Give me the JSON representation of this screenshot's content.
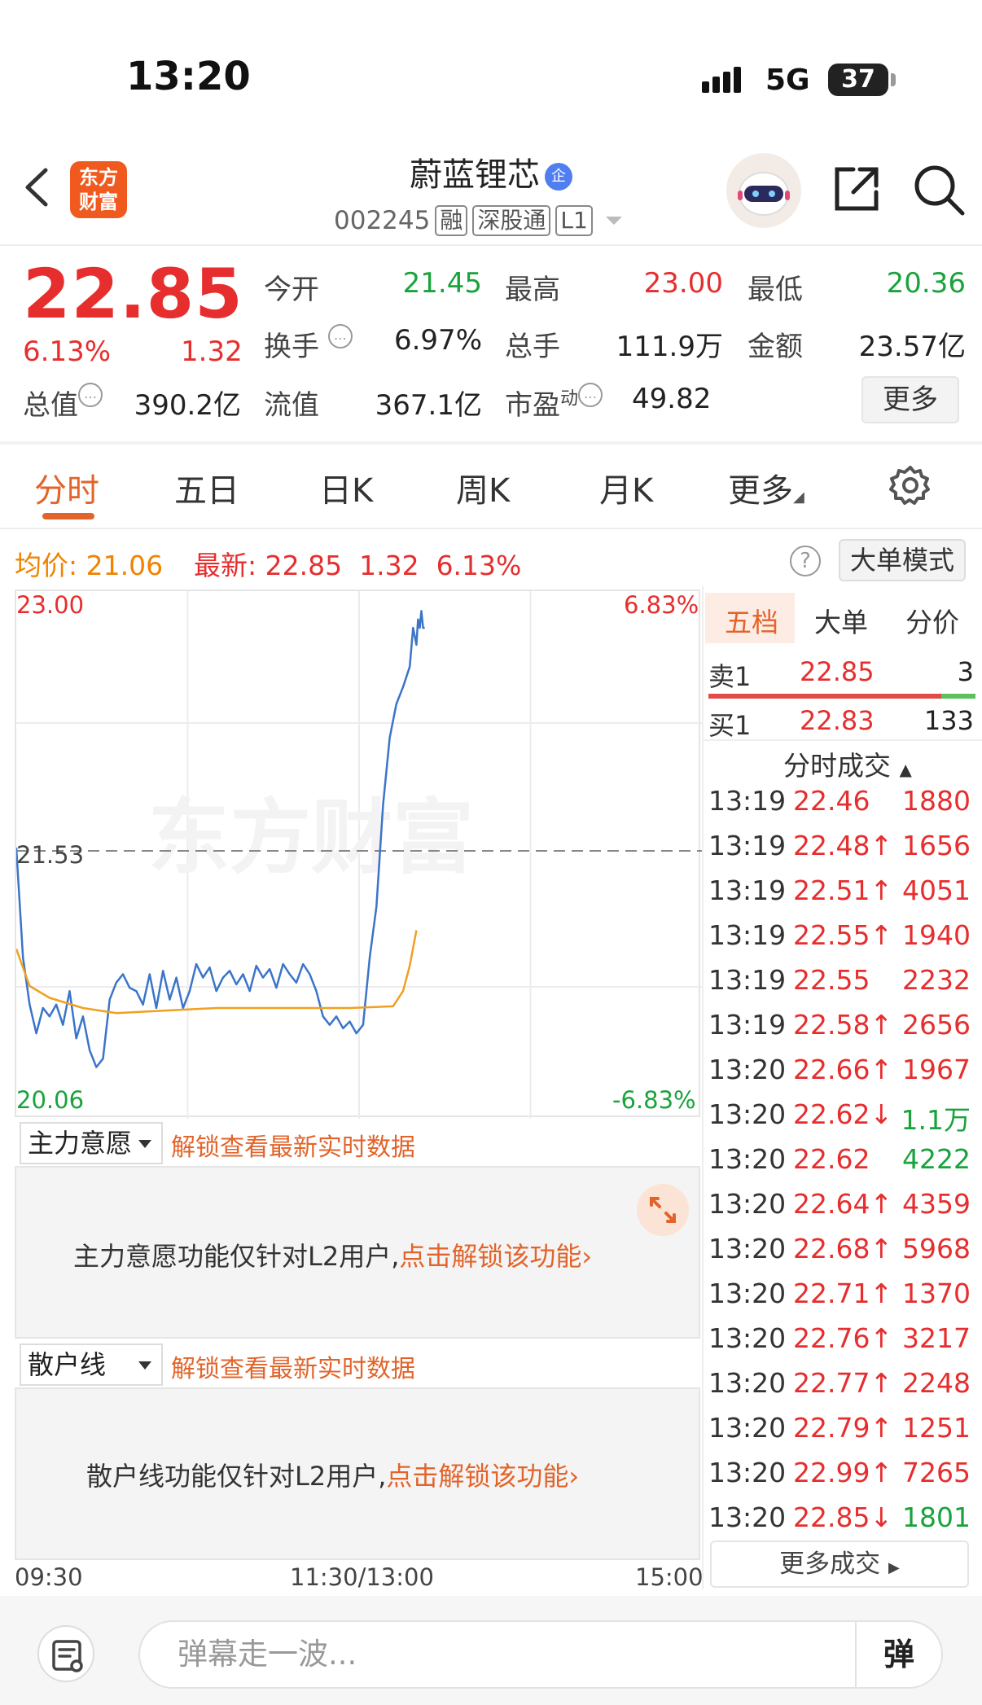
{
  "status_bar": {
    "time": "13:20",
    "network": "5G",
    "battery": "37"
  },
  "header": {
    "logo_line1": "东方",
    "logo_line2": "财富",
    "stock_name": "蔚蓝锂芯",
    "stock_badge": "企",
    "stock_code": "002245",
    "tags": [
      "融",
      "深股通",
      "L1"
    ]
  },
  "quote": {
    "price": "22.85",
    "change_pct": "6.13%",
    "change": "1.32",
    "fields": {
      "open_label": "今开",
      "open": "21.45",
      "high_label": "最高",
      "high": "23.00",
      "low_label": "最低",
      "low": "20.36",
      "turnover_label": "换手",
      "turnover": "6.97%",
      "volume_label": "总手",
      "volume": "111.9万",
      "amount_label": "金额",
      "amount": "23.57亿",
      "mktcap_label": "总值",
      "mktcap": "390.2亿",
      "float_label": "流值",
      "float": "367.1亿",
      "pe_label": "市盈",
      "pe_sup": "动",
      "pe": "49.82"
    },
    "more_label": "更多"
  },
  "tabs": [
    "分时",
    "五日",
    "日K",
    "周K",
    "月K",
    "更多"
  ],
  "chart_header": {
    "avg_label": "均价:",
    "avg": "21.06",
    "latest_label": "最新:",
    "latest": "22.85",
    "latest_chg": "1.32",
    "latest_pct": "6.13%",
    "mode_label": "大单模式"
  },
  "chart_data": {
    "type": "line",
    "y_left_ticks": [
      "23.00",
      "21.53",
      "20.06"
    ],
    "y_right_ticks": [
      "6.83%",
      "-6.83%"
    ],
    "x_ticks": [
      "09:30",
      "11:30/13:00",
      "15:00"
    ],
    "ylim": [
      20.06,
      23.0
    ],
    "prev_close": 21.53,
    "watermark": "东方财富",
    "series": [
      {
        "name": "price",
        "color": "#3b74c9",
        "x": [
          0,
          4,
          8,
          12,
          16,
          20,
          24,
          28,
          32,
          36,
          40,
          44,
          48,
          52,
          56,
          60,
          64,
          68,
          72,
          76,
          80,
          84,
          88,
          92,
          96,
          100,
          104,
          108,
          112,
          116,
          120,
          124,
          128,
          132,
          136,
          140,
          144,
          148,
          152,
          156,
          160,
          164,
          168,
          172,
          176,
          180,
          184,
          188,
          192,
          196,
          200,
          204,
          208,
          212,
          216,
          220,
          224,
          228,
          232,
          236,
          238,
          240,
          241,
          242,
          243,
          244,
          245
        ],
        "y": [
          21.55,
          20.9,
          20.62,
          20.45,
          20.6,
          20.55,
          20.62,
          20.5,
          20.7,
          20.42,
          20.55,
          20.35,
          20.25,
          20.3,
          20.65,
          20.75,
          20.8,
          20.72,
          20.7,
          20.62,
          20.8,
          20.6,
          20.82,
          20.65,
          20.78,
          20.6,
          20.7,
          20.86,
          20.78,
          20.84,
          20.7,
          20.78,
          20.82,
          20.74,
          20.8,
          20.7,
          20.85,
          20.78,
          20.83,
          20.72,
          20.86,
          20.8,
          20.75,
          20.86,
          20.8,
          20.7,
          20.55,
          20.5,
          20.55,
          20.48,
          20.52,
          20.45,
          20.5,
          20.9,
          21.2,
          21.8,
          22.2,
          22.4,
          22.5,
          22.62,
          22.85,
          22.75,
          22.9,
          22.85,
          22.95,
          22.85,
          22.85
        ],
        "x_max": 240
      },
      {
        "name": "avg",
        "color": "#f0a020",
        "x": [
          0,
          8,
          20,
          40,
          60,
          80,
          120,
          160,
          200,
          226,
          232,
          236,
          240
        ],
        "y": [
          20.95,
          20.73,
          20.66,
          20.6,
          20.57,
          20.58,
          20.6,
          20.6,
          20.6,
          20.61,
          20.7,
          20.85,
          21.06
        ],
        "x_max": 240
      }
    ]
  },
  "order_book": {
    "tabs": [
      "五档",
      "大单",
      "分价"
    ],
    "sell": {
      "label": "卖1",
      "price": "22.85",
      "vol": "3"
    },
    "buy": {
      "label": "买1",
      "price": "22.83",
      "vol": "133"
    },
    "trades_title": "分时成交",
    "trades": [
      {
        "t": "13:19",
        "p": "22.46",
        "arrow": "",
        "v": "1880",
        "c": "red"
      },
      {
        "t": "13:19",
        "p": "22.48",
        "arrow": "↑",
        "v": "1656",
        "c": "red"
      },
      {
        "t": "13:19",
        "p": "22.51",
        "arrow": "↑",
        "v": "4051",
        "c": "red"
      },
      {
        "t": "13:19",
        "p": "22.55",
        "arrow": "↑",
        "v": "1940",
        "c": "red"
      },
      {
        "t": "13:19",
        "p": "22.55",
        "arrow": "",
        "v": "2232",
        "c": "red"
      },
      {
        "t": "13:19",
        "p": "22.58",
        "arrow": "↑",
        "v": "2656",
        "c": "red"
      },
      {
        "t": "13:20",
        "p": "22.66",
        "arrow": "↑",
        "v": "1967",
        "c": "red"
      },
      {
        "t": "13:20",
        "p": "22.62",
        "arrow": "↓",
        "v": "1.1万",
        "c": "green"
      },
      {
        "t": "13:20",
        "p": "22.62",
        "arrow": "",
        "v": "4222",
        "c": "green"
      },
      {
        "t": "13:20",
        "p": "22.64",
        "arrow": "↑",
        "v": "4359",
        "c": "red"
      },
      {
        "t": "13:20",
        "p": "22.68",
        "arrow": "↑",
        "v": "5968",
        "c": "red"
      },
      {
        "t": "13:20",
        "p": "22.71",
        "arrow": "↑",
        "v": "1370",
        "c": "red"
      },
      {
        "t": "13:20",
        "p": "22.76",
        "arrow": "↑",
        "v": "3217",
        "c": "red"
      },
      {
        "t": "13:20",
        "p": "22.77",
        "arrow": "↑",
        "v": "2248",
        "c": "red"
      },
      {
        "t": "13:20",
        "p": "22.79",
        "arrow": "↑",
        "v": "1251",
        "c": "red"
      },
      {
        "t": "13:20",
        "p": "22.99",
        "arrow": "↑",
        "v": "7265",
        "c": "red"
      },
      {
        "t": "13:20",
        "p": "22.85",
        "arrow": "↓",
        "v": "1801",
        "c": "green"
      }
    ],
    "more_trades": "更多成交"
  },
  "panels": {
    "main_select": "主力意愿",
    "main_unlock_link": "解锁查看最新实时数据",
    "main_text": "主力意愿功能仅针对L2用户,",
    "main_link": "点击解锁该功能",
    "retail_select": "散户线",
    "retail_unlock_link": "解锁查看最新实时数据",
    "retail_text": "散户线功能仅针对L2用户,",
    "retail_link": "点击解锁该功能"
  },
  "bottom": {
    "placeholder": "弹幕走一波...",
    "danmu_btn": "弹"
  }
}
